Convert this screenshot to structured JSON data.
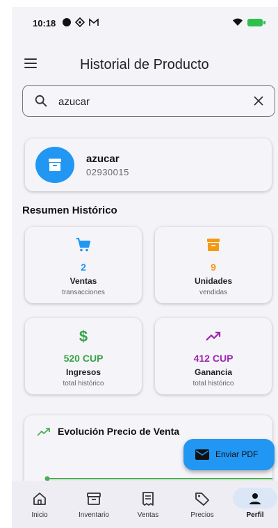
{
  "status_bar": {
    "time": "10:18"
  },
  "header": {
    "title": "Historial de Producto"
  },
  "search": {
    "value": "azucar",
    "placeholder": ""
  },
  "product": {
    "name": "azucar",
    "code": "02930015"
  },
  "summary": {
    "title": "Resumen Histórico",
    "cards": [
      {
        "value": "2",
        "label": "Ventas",
        "sub": "transacciones",
        "color": "#2196f3",
        "icon": "cart-icon"
      },
      {
        "value": "9",
        "label": "Unidades",
        "sub": "vendidas",
        "color": "#f59a14",
        "icon": "archive-icon"
      },
      {
        "value": "520 CUP",
        "label": "Ingresos",
        "sub": "total histórico",
        "color": "#3aa34a",
        "icon": "dollar-icon"
      },
      {
        "value": "412 CUP",
        "label": "Ganancia",
        "sub": "total histórico",
        "color": "#9c27b0",
        "icon": "trending-up-icon"
      }
    ]
  },
  "chart": {
    "title": "Evolución Precio de Venta",
    "line_color": "#4caf50"
  },
  "fab": {
    "label": "Enviar PDF"
  },
  "nav": {
    "items": [
      {
        "label": "Inicio",
        "icon": "home-icon",
        "active": false
      },
      {
        "label": "Inventario",
        "icon": "inventory-icon",
        "active": false
      },
      {
        "label": "Ventas",
        "icon": "receipt-icon",
        "active": false
      },
      {
        "label": "Precios",
        "icon": "tag-icon",
        "active": false
      },
      {
        "label": "Perfil",
        "icon": "person-icon",
        "active": true
      }
    ]
  }
}
